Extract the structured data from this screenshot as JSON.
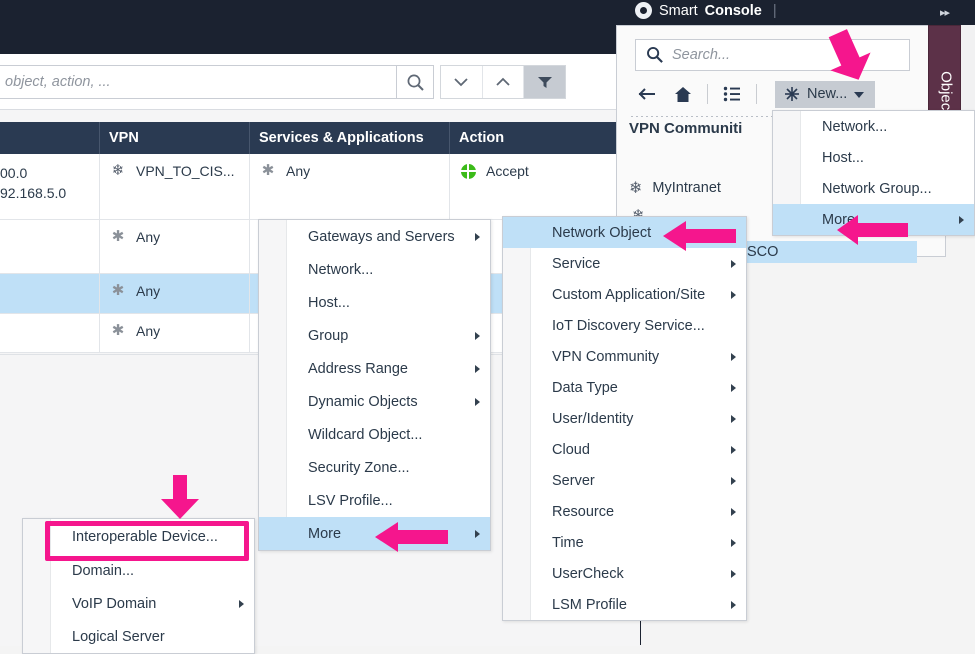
{
  "app": {
    "title_light": "Smart",
    "title_bold": "Console",
    "title_separator": "|",
    "logo_icon": "checkpoint-logo-icon"
  },
  "colors": {
    "titlebar": "#1b2230",
    "table_header": "#2a3a52",
    "selection": "#bfe0f7",
    "annotation_magenta": "#f5168d",
    "objects_tab": "#5c3148",
    "accept_green": "#3cbb19"
  },
  "policy_toolbar": {
    "search_placeholder": "object, action, ...",
    "search_icon": "search-icon",
    "prev_icon": "chevron-down-icon",
    "next_icon": "chevron-up-icon",
    "filter_icon": "filter-icon"
  },
  "rules_table": {
    "columns": [
      "",
      "VPN",
      "Services & Applications",
      "Action"
    ],
    "rows": [
      {
        "source_lines": [
          "00.0",
          "92.168.5.0"
        ],
        "vpn_icon": "vpn-community-icon",
        "vpn": "VPN_TO_CIS...",
        "services_icon": "any-asterisk-icon",
        "services": "Any",
        "action_icon": "accept-icon",
        "action": "Accept",
        "selected": false
      },
      {
        "source_lines": [
          ""
        ],
        "vpn_icon": "any-asterisk-icon",
        "vpn": "Any",
        "services_icon": "",
        "services": "",
        "action_icon": "",
        "action": "",
        "selected": false
      },
      {
        "source_lines": [
          ""
        ],
        "vpn_icon": "any-asterisk-icon",
        "vpn": "Any",
        "services_icon": "",
        "services": "",
        "action_icon": "",
        "action": "",
        "selected": true
      },
      {
        "source_lines": [
          ""
        ],
        "vpn_icon": "any-asterisk-icon",
        "vpn": "Any",
        "services_icon": "",
        "services": "",
        "action_icon": "",
        "action": "",
        "selected": false
      }
    ]
  },
  "objects_panel": {
    "tab_label": "Objects",
    "collapse_icon": "double-chevron-right-icon",
    "search_placeholder": "Search...",
    "search_icon": "search-icon",
    "back_icon": "arrow-left-icon",
    "home_icon": "home-icon",
    "list_icon": "list-view-icon",
    "new_icon": "new-object-asterisk-icon",
    "new_label": "New...",
    "new_caret_icon": "caret-down-icon",
    "group_title": "VPN Communiti",
    "items": [
      {
        "icon": "vpn-community-icon",
        "label": "MyIntranet"
      }
    ],
    "partial_row_label": "SCO"
  },
  "menu_new": {
    "name": "new-object-dropdown",
    "items": [
      {
        "label": "Network...",
        "submenu": false,
        "highlighted": false
      },
      {
        "label": "Host...",
        "submenu": false,
        "highlighted": false
      },
      {
        "label": "Network Group...",
        "submenu": false,
        "highlighted": false
      },
      {
        "label": "More",
        "submenu": true,
        "highlighted": true
      }
    ]
  },
  "menu_network_object": {
    "name": "more-submenu",
    "items": [
      {
        "label": "Network Object",
        "submenu": true,
        "highlighted": true
      },
      {
        "label": "Service",
        "submenu": true,
        "highlighted": false
      },
      {
        "label": "Custom Application/Site",
        "submenu": true,
        "highlighted": false
      },
      {
        "label": "IoT Discovery Service...",
        "submenu": false,
        "highlighted": false
      },
      {
        "label": "VPN Community",
        "submenu": true,
        "highlighted": false
      },
      {
        "label": "Data Type",
        "submenu": true,
        "highlighted": false
      },
      {
        "label": "User/Identity",
        "submenu": true,
        "highlighted": false
      },
      {
        "label": "Cloud",
        "submenu": true,
        "highlighted": false
      },
      {
        "label": "Server",
        "submenu": true,
        "highlighted": false
      },
      {
        "label": "Resource",
        "submenu": true,
        "highlighted": false
      },
      {
        "label": "Time",
        "submenu": true,
        "highlighted": false
      },
      {
        "label": "UserCheck",
        "submenu": true,
        "highlighted": false
      },
      {
        "label": "LSM Profile",
        "submenu": true,
        "highlighted": false
      }
    ]
  },
  "menu_gateways": {
    "name": "network-object-submenu",
    "items": [
      {
        "label": "Gateways and Servers",
        "submenu": true,
        "highlighted": false
      },
      {
        "label": "Network...",
        "submenu": false,
        "highlighted": false
      },
      {
        "label": "Host...",
        "submenu": false,
        "highlighted": false
      },
      {
        "label": "Group",
        "submenu": true,
        "highlighted": false
      },
      {
        "label": "Address Range",
        "submenu": true,
        "highlighted": false
      },
      {
        "label": "Dynamic Objects",
        "submenu": true,
        "highlighted": false
      },
      {
        "label": "Wildcard Object...",
        "submenu": false,
        "highlighted": false
      },
      {
        "label": "Security Zone...",
        "submenu": false,
        "highlighted": false
      },
      {
        "label": "LSV Profile...",
        "submenu": false,
        "highlighted": false
      },
      {
        "label": "More",
        "submenu": true,
        "highlighted": true
      }
    ]
  },
  "menu_more": {
    "name": "more-network-object-submenu",
    "items": [
      {
        "label": "Interoperable Device...",
        "submenu": false,
        "highlighted": false
      },
      {
        "label": "Domain...",
        "submenu": false,
        "highlighted": false
      },
      {
        "label": "VoIP Domain",
        "submenu": true,
        "highlighted": false
      },
      {
        "label": "Logical Server",
        "submenu": false,
        "highlighted": false
      }
    ]
  },
  "annotations": {
    "arrow_new_button": "down-right-arrow-annotation",
    "arrow_more_top": "left-arrow-annotation",
    "arrow_network_object": "left-arrow-annotation",
    "arrow_more_middle": "left-arrow-annotation",
    "arrow_interoperable": "down-arrow-annotation",
    "highlight_box_target": "Interoperable Device..."
  }
}
